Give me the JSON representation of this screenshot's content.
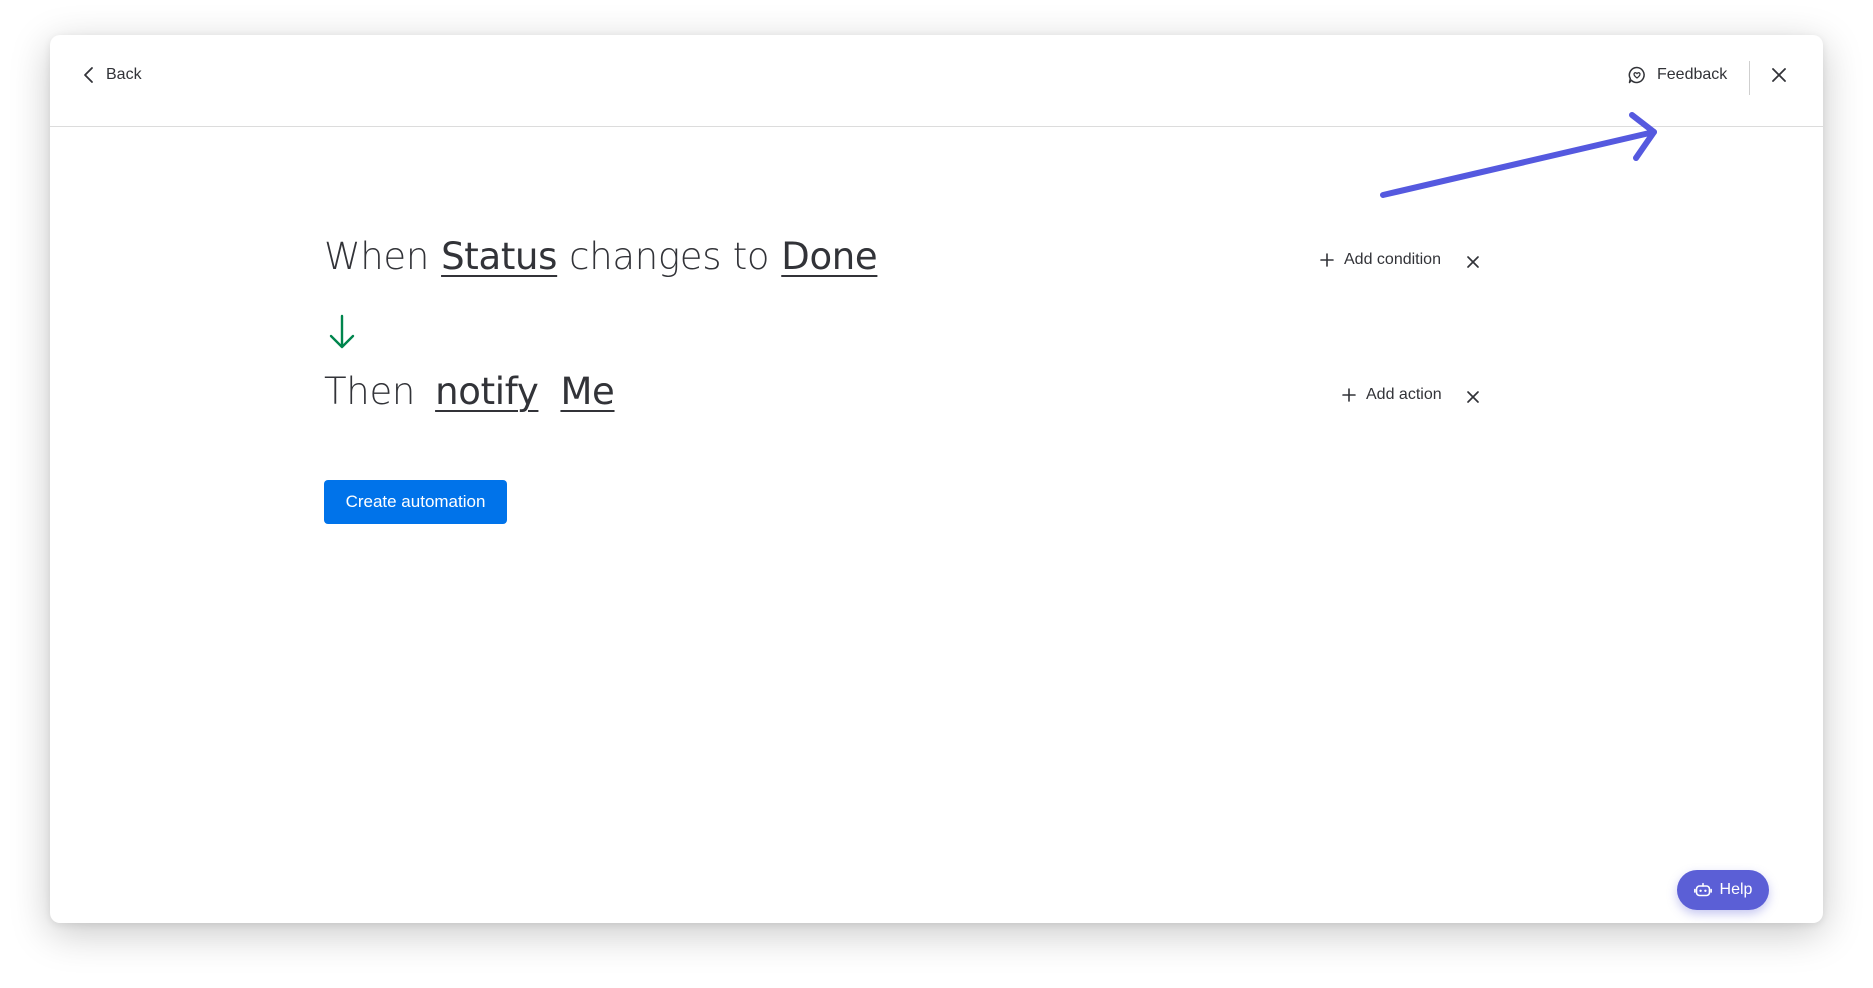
{
  "header": {
    "back_label": "Back",
    "feedback_label": "Feedback"
  },
  "trigger": {
    "prefix": "When",
    "column": "Status",
    "middle": "changes to",
    "value": "Done",
    "add_label": "Add condition"
  },
  "action": {
    "prefix": "Then",
    "verb": "notify",
    "target": "Me",
    "add_label": "Add action"
  },
  "create_button_label": "Create automation",
  "help_label": "Help",
  "colors": {
    "primary": "#0073ea",
    "flow_arrow": "#00854d",
    "annotation_arrow": "#5559df",
    "help_button": "#5b5fd6"
  },
  "icons": {
    "back": "chevron-left-icon",
    "feedback": "chat-bubble-icon",
    "close": "close-icon",
    "flow": "arrow-down-icon",
    "add": "plus-icon",
    "help": "robot-icon"
  }
}
